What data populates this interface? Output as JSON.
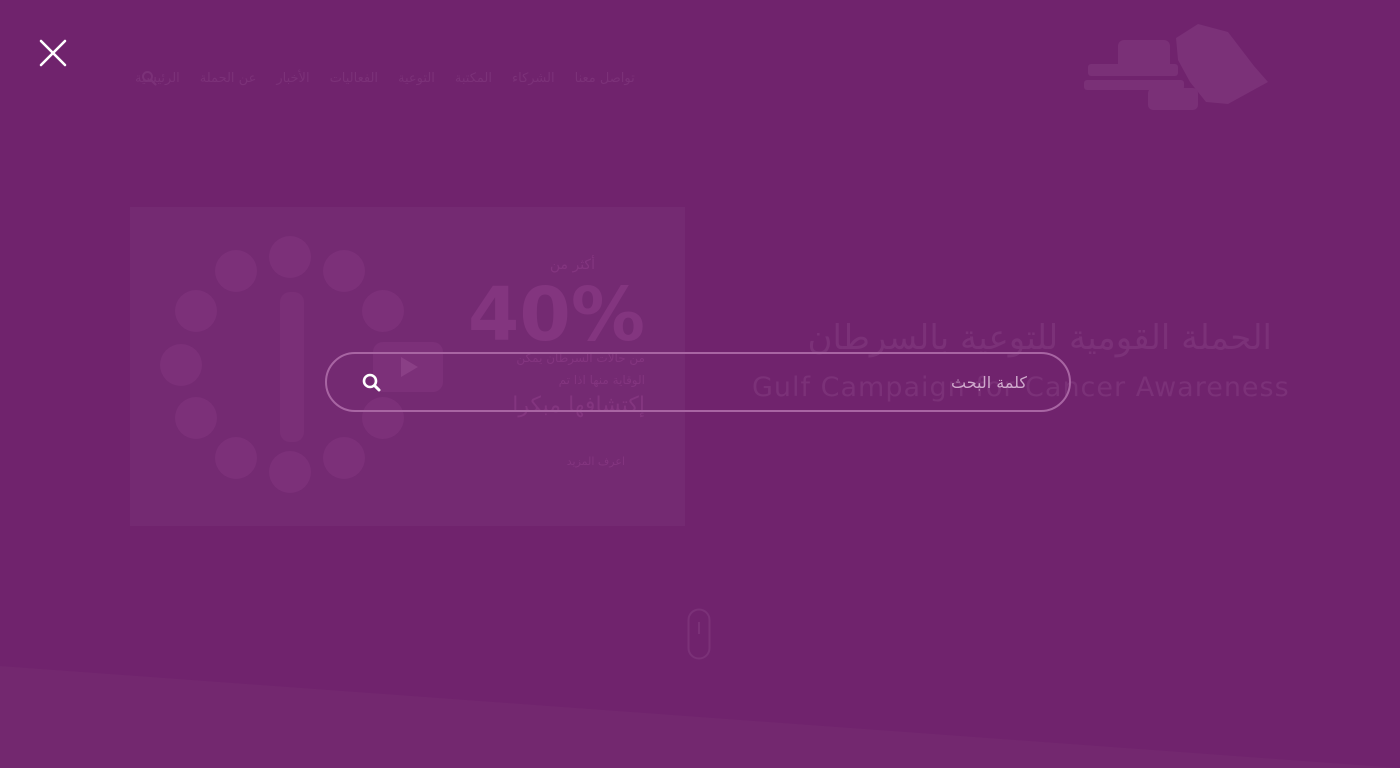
{
  "overlay": {
    "close_icon": "close-icon",
    "search": {
      "placeholder": "كلمة البحث",
      "value": "",
      "button_icon": "search-icon"
    }
  },
  "background": {
    "nav": {
      "items": [
        "الرئيسية",
        "عن الحملة",
        "الأخبار",
        "الفعاليات",
        "التوعية",
        "المكتبة",
        "الشركاء",
        "تواصل معنا"
      ],
      "search_icon": "search-icon"
    },
    "hero": {
      "title": "الحملة القومية للتوعية بالسرطان",
      "subtitle": "Gulf Campaign for Cancer Awareness"
    },
    "card": {
      "kicker": "أكثر من",
      "percent": "40%",
      "line1": "من حالات السرطان يمكن",
      "line2": "الوقاية منها اذا تم",
      "big": "إكتشافها مبكرا",
      "footer": "اعرف المزيد",
      "play_icon": "play-icon"
    },
    "scroll_icon": "scroll-down-icon",
    "logo_icon": "campaign-logo-icon"
  },
  "colors": {
    "background": "#70236d",
    "search_border": "#a865a3",
    "placeholder": "#cfa9cc",
    "icon": "#ffffff"
  }
}
